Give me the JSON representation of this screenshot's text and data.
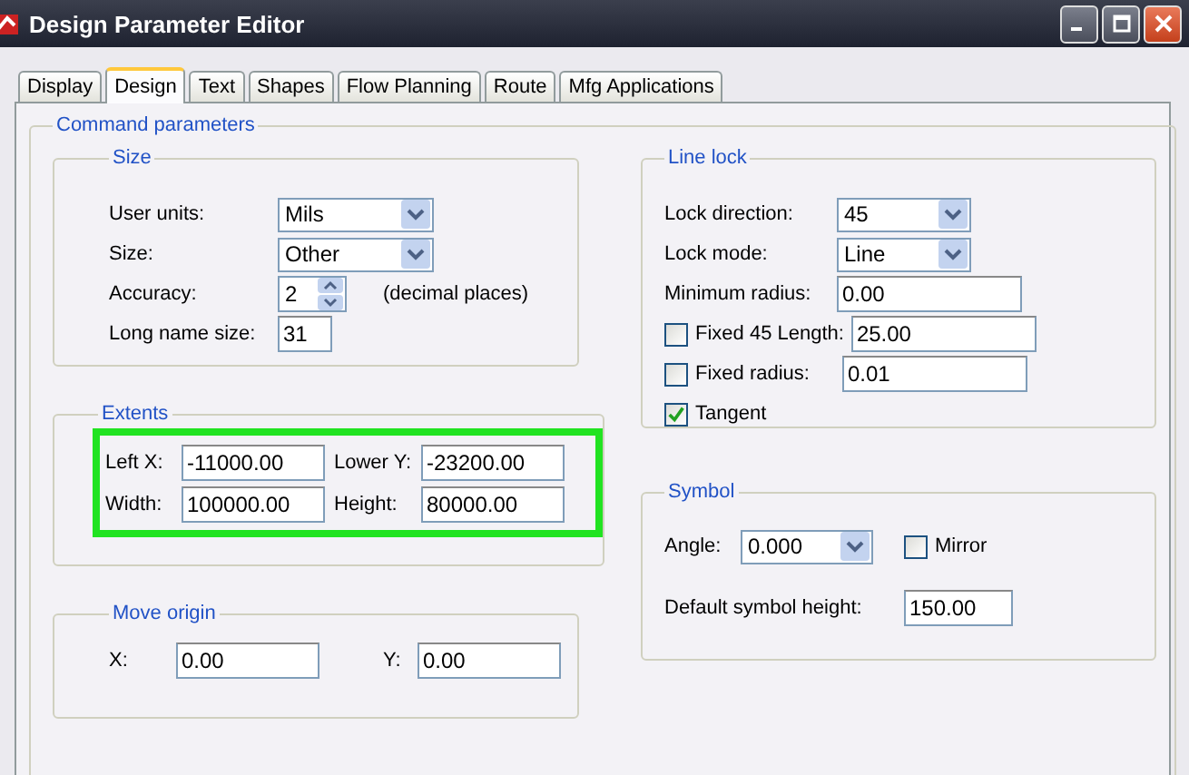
{
  "window": {
    "title": "Design Parameter Editor"
  },
  "tabs": [
    {
      "label": "Display",
      "selected": false
    },
    {
      "label": "Design",
      "selected": true
    },
    {
      "label": "Text",
      "selected": false
    },
    {
      "label": "Shapes",
      "selected": false
    },
    {
      "label": "Flow Planning",
      "selected": false
    },
    {
      "label": "Route",
      "selected": false
    },
    {
      "label": "Mfg Applications",
      "selected": false
    }
  ],
  "command_parameters": {
    "title": "Command parameters",
    "size": {
      "title": "Size",
      "rows": [
        {
          "kind": "dropdown",
          "label": "User units:",
          "value": "Mils"
        },
        {
          "kind": "dropdown",
          "label": "Size:",
          "value": "Other"
        },
        {
          "kind": "spinner",
          "label": "Accuracy:",
          "value": "2",
          "note": "(decimal places)"
        },
        {
          "kind": "field",
          "label": "Long name size:",
          "value": "31"
        }
      ]
    },
    "extents": {
      "title": "Extents",
      "highlighted": true,
      "fields": [
        {
          "label": "Left X:",
          "value": "-11000.00"
        },
        {
          "label": "Lower Y:",
          "value": "-23200.00"
        },
        {
          "label": "Width:",
          "value": "100000.00"
        },
        {
          "label": "Height:",
          "value": "80000.00"
        }
      ]
    },
    "move_origin": {
      "title": "Move origin",
      "fields": [
        {
          "label": "X:",
          "value": "0.00"
        },
        {
          "label": "Y:",
          "value": "0.00"
        }
      ]
    },
    "line_lock": {
      "title": "Line lock",
      "rows": [
        {
          "kind": "dropdown",
          "label": "Lock direction:",
          "value": "45"
        },
        {
          "kind": "dropdown",
          "label": "Lock mode:",
          "value": "Line"
        },
        {
          "kind": "field",
          "label": "Minimum radius:",
          "value": "0.00"
        },
        {
          "kind": "check-field",
          "label": "Fixed 45 Length:",
          "checked": false,
          "value": "25.00"
        },
        {
          "kind": "check-field",
          "label": "Fixed radius:",
          "checked": false,
          "value": "0.01"
        },
        {
          "kind": "check",
          "label": "Tangent",
          "checked": true
        }
      ]
    },
    "symbol": {
      "title": "Symbol",
      "angle": {
        "label": "Angle:",
        "value": "0.000"
      },
      "mirror": {
        "label": "Mirror",
        "checked": false
      },
      "height": {
        "label": "Default symbol height:",
        "value": "150.00"
      }
    }
  }
}
